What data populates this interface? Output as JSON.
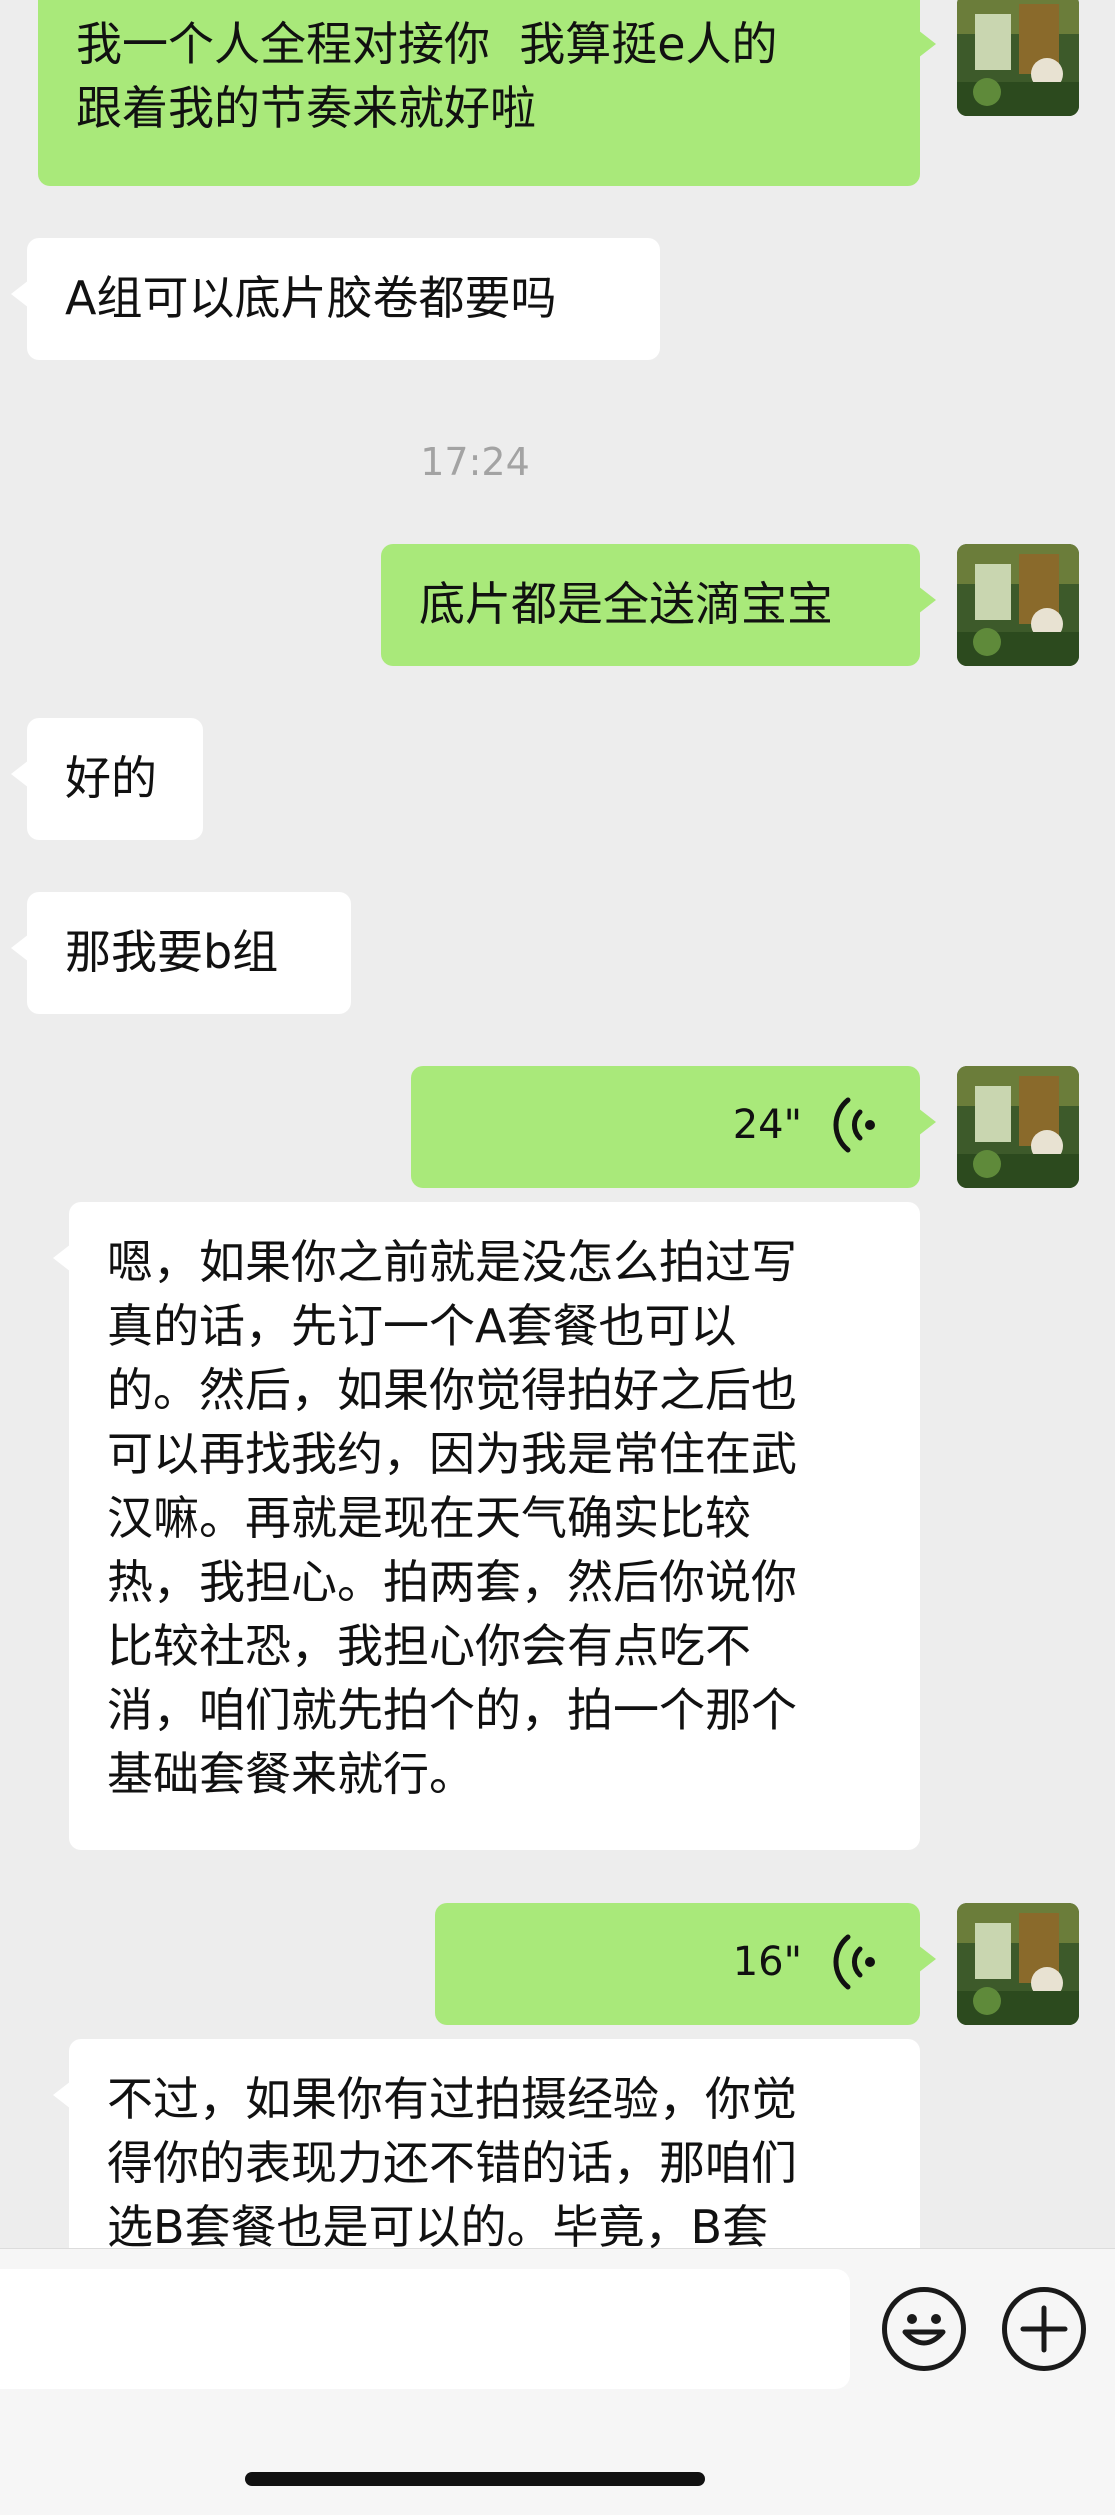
{
  "messages": [
    {
      "id": "m1",
      "direction": "out",
      "type": "text",
      "text": "我一个人全程对接你  我算挺e人的\n跟着我的节奏来就好啦"
    },
    {
      "id": "m2",
      "direction": "in",
      "type": "text",
      "text": "A组可以底片胶卷都要吗"
    },
    {
      "id": "m3",
      "direction": "out",
      "type": "text",
      "text": "底片都是全送滴宝宝"
    },
    {
      "id": "m4",
      "direction": "in",
      "type": "text",
      "text": "好的"
    },
    {
      "id": "m5",
      "direction": "in",
      "type": "text",
      "text": "那我要b组"
    },
    {
      "id": "m6",
      "direction": "out",
      "type": "voice",
      "duration": "24\""
    },
    {
      "id": "m7",
      "direction": "in",
      "type": "text",
      "text": "嗯，如果你之前就是没怎么拍过写\n真的话，先订一个A套餐也可以\n的。然后，如果你觉得拍好之后也\n可以再找我约，因为我是常住在武\n汉嘛。再就是现在天气确实比较\n热，我担心。拍两套，然后你说你\n比较社恐，我担心你会有点吃不\n消，咱们就先拍个的，拍一个那个\n基础套餐来就行。"
    },
    {
      "id": "m8",
      "direction": "out",
      "type": "voice",
      "duration": "16\""
    },
    {
      "id": "m9",
      "direction": "in",
      "type": "text",
      "text": "不过，如果你有过拍摄经验，你觉\n得你的表现力还不错的话，那咱们\n选B套餐也是可以的。毕竟，B套"
    }
  ],
  "timestamp": "17:24",
  "input_bar": {
    "emoji_button_icon": "smiley-face-icon",
    "plus_button_icon": "plus-circle-icon"
  },
  "colors": {
    "outgoing_bubble": "#a9e97a",
    "incoming_bubble": "#ffffff",
    "background": "#ededed"
  }
}
